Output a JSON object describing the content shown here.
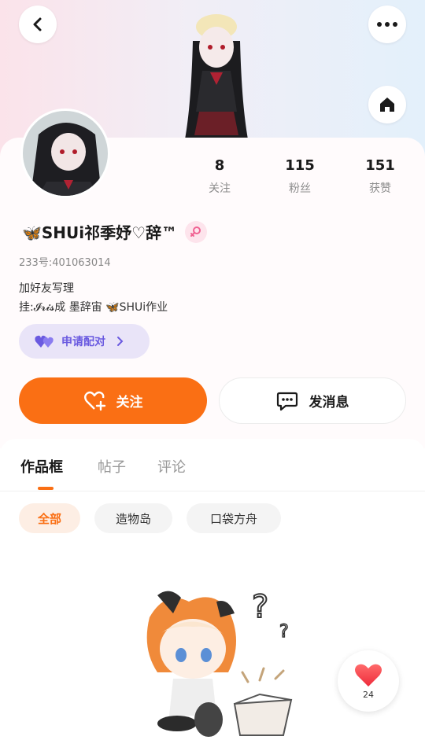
{
  "header": {
    "back_icon": "chevron-left-icon",
    "more_icon": "more-dots-icon",
    "home_icon": "home-icon"
  },
  "profile": {
    "name": "🦋SHUi祁季妤♡辞™",
    "gender_icon": "female-icon",
    "uid": "233号:401063014",
    "bio_line1": "加好友写理",
    "bio_line2": "挂:𝓘𝓻𝓲𝓼成 墨辞宙 🦋SHUi作业",
    "pair_label": "申请配对"
  },
  "stats": [
    {
      "value": "8",
      "label": "关注"
    },
    {
      "value": "115",
      "label": "粉丝"
    },
    {
      "value": "151",
      "label": "获赞"
    }
  ],
  "actions": {
    "follow_label": "关注",
    "message_label": "发消息"
  },
  "tabs": [
    {
      "label": "作品框"
    },
    {
      "label": "帖子"
    },
    {
      "label": "评论"
    }
  ],
  "chips": [
    {
      "label": "全部"
    },
    {
      "label": "造物岛"
    },
    {
      "label": "口袋方舟"
    }
  ],
  "fab": {
    "count": "24"
  },
  "colors": {
    "accent": "#fa6f14",
    "pair_text": "#6a5ae0",
    "gender_bg": "#fde4ec"
  }
}
